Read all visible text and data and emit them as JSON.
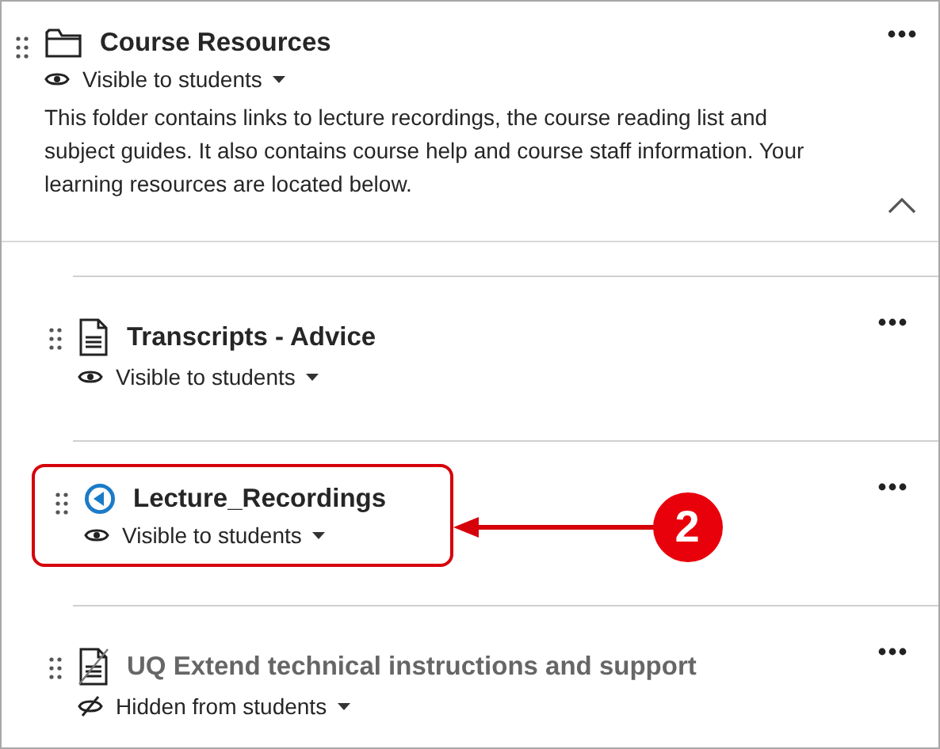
{
  "folder": {
    "title": "Course Resources",
    "visibility": {
      "label": "Visible to students",
      "visible": true
    },
    "description": "This folder contains links to lecture recordings, the course reading list and subject guides. It also contains course help and course staff information. Your learning resources are located below.",
    "expanded": true
  },
  "items": [
    {
      "kind": "document",
      "title": "Transcripts - Advice",
      "visibility": {
        "label": "Visible to students",
        "visible": true
      },
      "highlighted": false
    },
    {
      "kind": "recording",
      "title": "Lecture_Recordings",
      "visibility": {
        "label": "Visible to students",
        "visible": true
      },
      "highlighted": true,
      "callout": "2"
    },
    {
      "kind": "document",
      "title": "UQ Extend technical instructions and support",
      "visibility": {
        "label": "Hidden from students",
        "visible": false
      },
      "highlighted": false
    }
  ]
}
